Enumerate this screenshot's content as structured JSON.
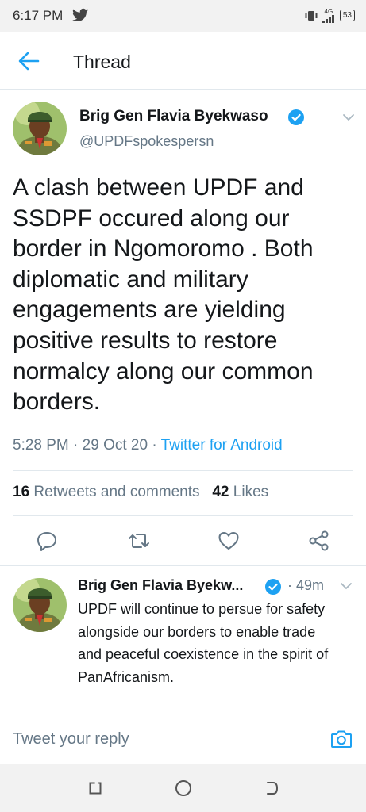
{
  "status_bar": {
    "time": "6:17 PM",
    "network": "4G",
    "battery": "53",
    "icons": [
      "twitter-bird-icon",
      "vibrate-icon",
      "signal-icon",
      "battery-icon"
    ]
  },
  "header": {
    "title": "Thread",
    "back_icon": "arrow-left-icon"
  },
  "tweet": {
    "author_name": "Brig Gen Flavia Byekwaso",
    "handle": "@UPDFspokespersn",
    "verified": true,
    "text": "A clash between UPDF and SSDPF occured along our border in Ngomoromo . Both diplomatic and military engagements are yielding positive results to restore normalcy along our common borders.",
    "time": "5:28 PM",
    "date": "29 Oct 20",
    "separator": "·",
    "source": "Twitter for Android",
    "retweets_count": "16",
    "retweets_label": "Retweets and comments",
    "likes_count": "42",
    "likes_label": "Likes",
    "actions": [
      "reply-icon",
      "retweet-icon",
      "like-icon",
      "share-icon"
    ]
  },
  "reply": {
    "author_name": "Brig Gen Flavia Byekw...",
    "time": "· 49m",
    "text": "UPDF will continue to persue for safety alongside our borders to enable trade and peaceful coexistence in the spirit of PanAfricanism."
  },
  "compose": {
    "placeholder": "Tweet your reply",
    "camera_icon": "camera-icon"
  },
  "nav": {
    "icons": [
      "recents-icon",
      "home-icon",
      "back-icon"
    ]
  },
  "colors": {
    "accent": "#1da1f2",
    "text": "#14171a",
    "secondary": "#657786",
    "border": "#e1e8ed"
  }
}
